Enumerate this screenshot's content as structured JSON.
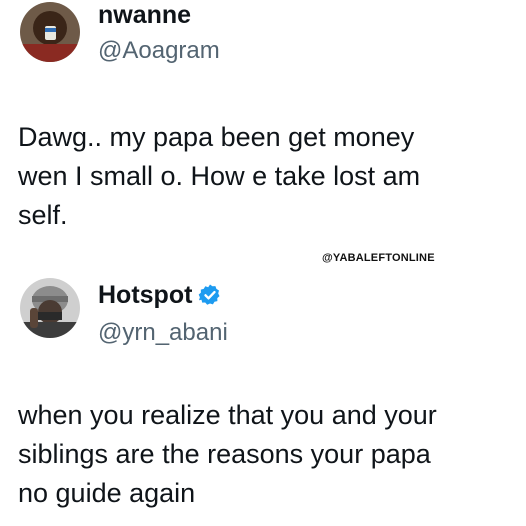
{
  "watermark": "@YABALEFTONLINE",
  "tweets": [
    {
      "name": "nwanne",
      "handle": "@Aoagram",
      "text": "Dawg.. my papa been get money\nwen I small o. How e take lost am\nself.",
      "verified": false,
      "avatar_icon": "avatar-man-drinking"
    },
    {
      "name": "Hotspot",
      "handle": "@yrn_abani",
      "text": "when you realize that you and your\nsiblings are the reasons your papa\nno guide again",
      "verified": true,
      "avatar_icon": "avatar-man-hoodie-mask"
    }
  ],
  "colors": {
    "handle": "#536471",
    "text": "#0f1419",
    "verified_badge": "#1d9bf0"
  }
}
